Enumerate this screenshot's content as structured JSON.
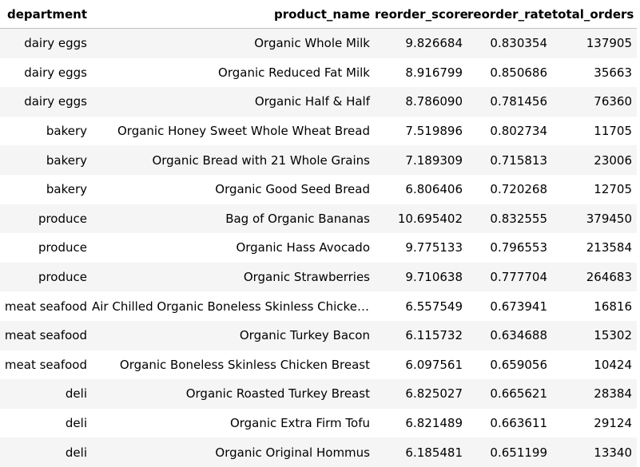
{
  "table": {
    "columns": [
      "department",
      "product_name",
      "reorder_score",
      "reorder_rate",
      "total_orders"
    ],
    "rows": [
      {
        "department": "dairy eggs",
        "product_name": "Organic Whole Milk",
        "reorder_score": "9.826684",
        "reorder_rate": "0.830354",
        "total_orders": "137905"
      },
      {
        "department": "dairy eggs",
        "product_name": "Organic Reduced Fat Milk",
        "reorder_score": "8.916799",
        "reorder_rate": "0.850686",
        "total_orders": "35663"
      },
      {
        "department": "dairy eggs",
        "product_name": "Organic Half & Half",
        "reorder_score": "8.786090",
        "reorder_rate": "0.781456",
        "total_orders": "76360"
      },
      {
        "department": "bakery",
        "product_name": "Organic Honey Sweet Whole Wheat Bread",
        "reorder_score": "7.519896",
        "reorder_rate": "0.802734",
        "total_orders": "11705"
      },
      {
        "department": "bakery",
        "product_name": "Organic Bread with 21 Whole Grains",
        "reorder_score": "7.189309",
        "reorder_rate": "0.715813",
        "total_orders": "23006"
      },
      {
        "department": "bakery",
        "product_name": "Organic Good Seed Bread",
        "reorder_score": "6.806406",
        "reorder_rate": "0.720268",
        "total_orders": "12705"
      },
      {
        "department": "produce",
        "product_name": "Bag of Organic Bananas",
        "reorder_score": "10.695402",
        "reorder_rate": "0.832555",
        "total_orders": "379450"
      },
      {
        "department": "produce",
        "product_name": "Organic Hass Avocado",
        "reorder_score": "9.775133",
        "reorder_rate": "0.796553",
        "total_orders": "213584"
      },
      {
        "department": "produce",
        "product_name": "Organic Strawberries",
        "reorder_score": "9.710638",
        "reorder_rate": "0.777704",
        "total_orders": "264683"
      },
      {
        "department": "meat seafood",
        "product_name": "Air Chilled Organic Boneless Skinless Chicken ...",
        "reorder_score": "6.557549",
        "reorder_rate": "0.673941",
        "total_orders": "16816"
      },
      {
        "department": "meat seafood",
        "product_name": "Organic Turkey Bacon",
        "reorder_score": "6.115732",
        "reorder_rate": "0.634688",
        "total_orders": "15302"
      },
      {
        "department": "meat seafood",
        "product_name": "Organic Boneless Skinless Chicken Breast",
        "reorder_score": "6.097561",
        "reorder_rate": "0.659056",
        "total_orders": "10424"
      },
      {
        "department": "deli",
        "product_name": "Organic Roasted Turkey Breast",
        "reorder_score": "6.825027",
        "reorder_rate": "0.665621",
        "total_orders": "28384"
      },
      {
        "department": "deli",
        "product_name": "Organic Extra Firm Tofu",
        "reorder_score": "6.821489",
        "reorder_rate": "0.663611",
        "total_orders": "29124"
      },
      {
        "department": "deli",
        "product_name": "Organic Original Hommus",
        "reorder_score": "6.185481",
        "reorder_rate": "0.651199",
        "total_orders": "13340"
      }
    ]
  }
}
